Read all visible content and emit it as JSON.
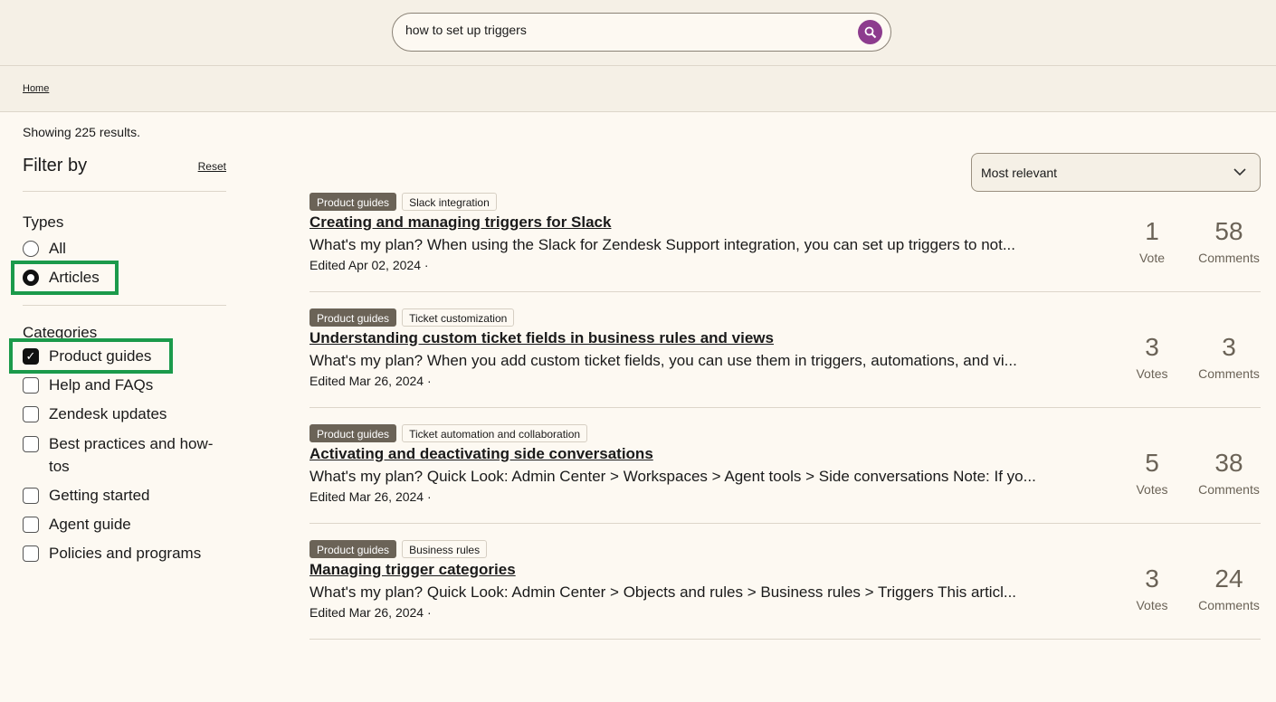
{
  "search": {
    "value": "how to set up triggers",
    "icon": "search-icon",
    "button_color": "#8d3c8e"
  },
  "breadcrumb": {
    "home": "Home"
  },
  "sidebar": {
    "showing": "Showing 225 results.",
    "filter_by": "Filter by",
    "reset": "Reset",
    "types_heading": "Types",
    "types": [
      {
        "label": "All",
        "selected": false
      },
      {
        "label": "Articles",
        "selected": true
      }
    ],
    "categories_heading": "Categories",
    "categories": [
      {
        "label": "Product guides",
        "checked": true
      },
      {
        "label": "Help and FAQs",
        "checked": false
      },
      {
        "label": "Zendesk updates",
        "checked": false
      },
      {
        "label": "Best practices and how-tos",
        "checked": false
      },
      {
        "label": "Getting started",
        "checked": false
      },
      {
        "label": "Agent guide",
        "checked": false
      },
      {
        "label": "Policies and programs",
        "checked": false
      }
    ],
    "highlight_color": "#1b9a4b"
  },
  "sort": {
    "selected": "Most relevant"
  },
  "results": [
    {
      "category": "Product guides",
      "section": "Slack integration",
      "title": "Creating and managing triggers for Slack",
      "excerpt": "What's my plan? When using the Slack for Zendesk Support integration, you can set up triggers to not...",
      "edited": "Edited Apr 02, 2024 ·",
      "votes": "1",
      "votes_label": "Vote",
      "comments": "58",
      "comments_label": "Comments"
    },
    {
      "category": "Product guides",
      "section": "Ticket customization",
      "title": "Understanding custom ticket fields in business rules and views",
      "excerpt": "What's my plan? When you add custom ticket fields, you can use them in triggers, automations, and vi...",
      "edited": "Edited Mar 26, 2024 ·",
      "votes": "3",
      "votes_label": "Votes",
      "comments": "3",
      "comments_label": "Comments"
    },
    {
      "category": "Product guides",
      "section": "Ticket automation and collaboration",
      "title": "Activating and deactivating side conversations",
      "excerpt": "What's my plan? Quick Look: Admin Center > Workspaces > Agent tools > Side conversations Note: If yo...",
      "edited": "Edited Mar 26, 2024 ·",
      "votes": "5",
      "votes_label": "Votes",
      "comments": "38",
      "comments_label": "Comments"
    },
    {
      "category": "Product guides",
      "section": "Business rules",
      "title": "Managing trigger categories",
      "excerpt": "What's my plan? Quick Look: Admin Center > Objects and rules > Business rules > Triggers This articl...",
      "edited": "Edited Mar 26, 2024 ·",
      "votes": "3",
      "votes_label": "Votes",
      "comments": "24",
      "comments_label": "Comments"
    }
  ]
}
